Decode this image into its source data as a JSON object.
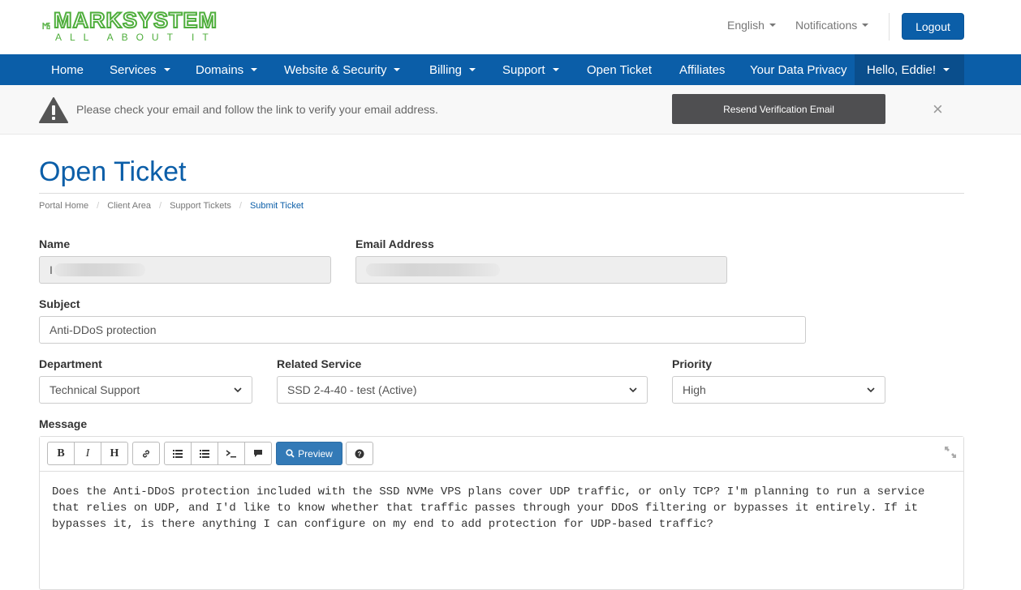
{
  "header": {
    "brand_name": "MARKSYSTEM",
    "brand_tagline": "ALL ABOUT IT",
    "language": "English",
    "notifications": "Notifications",
    "logout": "Logout"
  },
  "nav": {
    "items": [
      {
        "label": "Home",
        "dropdown": false
      },
      {
        "label": "Services",
        "dropdown": true
      },
      {
        "label": "Domains",
        "dropdown": true
      },
      {
        "label": "Website & Security",
        "dropdown": true
      },
      {
        "label": "Billing",
        "dropdown": true
      },
      {
        "label": "Support",
        "dropdown": true
      },
      {
        "label": "Open Ticket",
        "dropdown": false
      },
      {
        "label": "Affiliates",
        "dropdown": false
      },
      {
        "label": "Your Data Privacy",
        "dropdown": false
      }
    ],
    "user_menu": "Hello, Eddie!"
  },
  "alert": {
    "message": "Please check your email and follow the link to verify your email address.",
    "resend_button": "Resend Verification Email",
    "close": "×"
  },
  "page": {
    "title": "Open Ticket",
    "breadcrumb": [
      "Portal Home",
      "Client Area",
      "Support Tickets",
      "Submit Ticket"
    ]
  },
  "form": {
    "name_label": "Name",
    "name_value": "I",
    "email_label": "Email Address",
    "subject_label": "Subject",
    "subject_value": "Anti-DDoS protection",
    "department_label": "Department",
    "department_value": "Technical Support",
    "related_service_label": "Related Service",
    "related_service_value": "SSD 2-4-40 - test (Active)",
    "priority_label": "Priority",
    "priority_value": "High",
    "message_label": "Message",
    "preview_label": "Preview",
    "message_value": "Does the Anti-DDoS protection included with the SSD NVMe VPS plans cover UDP traffic, or only TCP? I'm planning to run a service that relies on UDP, and I'd like to know whether that traffic passes through your DDoS filtering or bypasses it entirely. If it bypasses it, is there anything I can configure on my end to add protection for UDP-based traffic?"
  },
  "toolbar_icons": [
    "bold-icon",
    "italic-icon",
    "heading-icon",
    "link-icon",
    "unordered-list-icon",
    "ordered-list-icon",
    "code-icon",
    "quote-icon",
    "search-icon",
    "help-icon",
    "fullscreen-icon"
  ],
  "colors": {
    "brand_blue": "#0b5ea8",
    "logo_green": "#4fae3c",
    "resend_gray": "#4f4f51",
    "preview_blue": "#337ab7"
  }
}
